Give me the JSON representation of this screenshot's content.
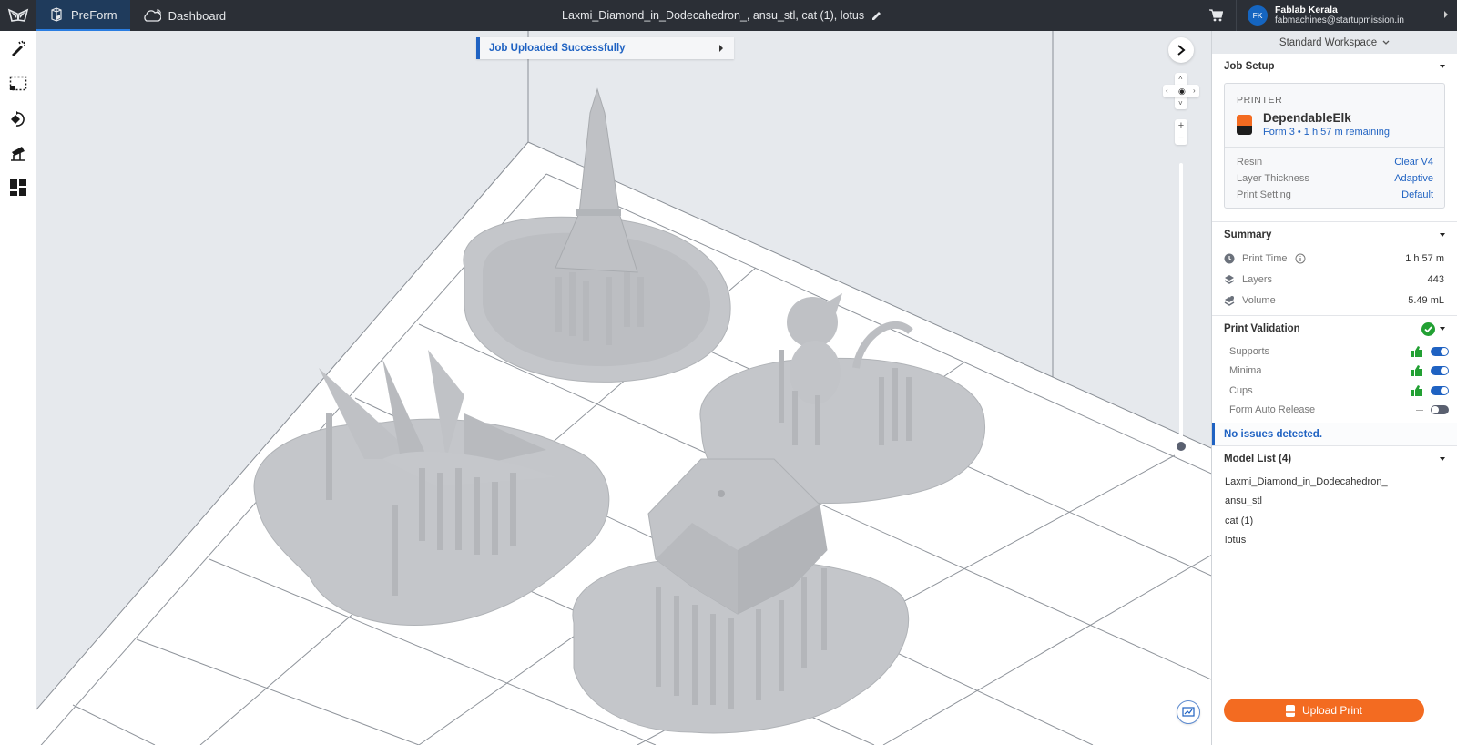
{
  "topbar": {
    "tabs": [
      {
        "label": "PreForm",
        "icon": "printer-box-icon",
        "active": true
      },
      {
        "label": "Dashboard",
        "icon": "cloud-icon",
        "active": false
      }
    ],
    "document_title": "Laxmi_Diamond_in_Dodecahedron_, ansu_stl, cat (1), lotus",
    "account": {
      "initials": "FK",
      "name": "Fablab Kerala",
      "email": "fabmachines@startupmission.in"
    }
  },
  "toolbar": {
    "tools": [
      {
        "name": "auto-setup",
        "icon": "magic-wand-icon"
      },
      {
        "name": "select",
        "icon": "selection-box-icon"
      },
      {
        "name": "orient",
        "icon": "orient-rotate-icon"
      },
      {
        "name": "supports",
        "icon": "supports-icon"
      },
      {
        "name": "layout",
        "icon": "layout-grid-icon"
      }
    ]
  },
  "viewport": {
    "toast": "Job Uploaded Successfully",
    "layer_slider_fraction": 0.0,
    "models": [
      {
        "name": "ansu_stl",
        "shape": "eiffel-tower"
      },
      {
        "name": "lotus",
        "shape": "lotus"
      },
      {
        "name": "cat (1)",
        "shape": "cat"
      },
      {
        "name": "Laxmi_Diamond_in_Dodecahedron_",
        "shape": "dodecahedron"
      }
    ]
  },
  "panel": {
    "workspace": "Standard Workspace",
    "job_setup": {
      "title": "Job Setup",
      "printer_label": "PRINTER",
      "printer_name": "DependableElk",
      "printer_status": "Form 3 • 1 h 57 m remaining",
      "rows": [
        {
          "key": "Resin",
          "value": "Clear V4"
        },
        {
          "key": "Layer Thickness",
          "value": "Adaptive"
        },
        {
          "key": "Print Setting",
          "value": "Default"
        }
      ]
    },
    "summary": {
      "title": "Summary",
      "rows": [
        {
          "key": "Print Time",
          "value": "1 h 57 m",
          "icon": "clock-icon"
        },
        {
          "key": "Layers",
          "value": "443",
          "icon": "layers-icon"
        },
        {
          "key": "Volume",
          "value": "5.49 mL",
          "icon": "volume-icon"
        }
      ]
    },
    "validation": {
      "title": "Print Validation",
      "status": "pass",
      "rows": [
        {
          "key": "Supports",
          "ok": true,
          "enabled": true
        },
        {
          "key": "Minima",
          "ok": true,
          "enabled": true
        },
        {
          "key": "Cups",
          "ok": true,
          "enabled": true
        },
        {
          "key": "Form Auto Release",
          "ok": null,
          "enabled": false
        }
      ],
      "message": "No issues detected."
    },
    "models": {
      "title": "Model List (4)",
      "items": [
        "Laxmi_Diamond_in_Dodecahedron_",
        "ansu_stl",
        "cat (1)",
        "lotus"
      ]
    },
    "upload_button": "Upload Print"
  },
  "colors": {
    "accent": "#1f62c2",
    "upload": "#f36b21",
    "topbar": "#2b2f36",
    "ok_green": "#22a033"
  }
}
